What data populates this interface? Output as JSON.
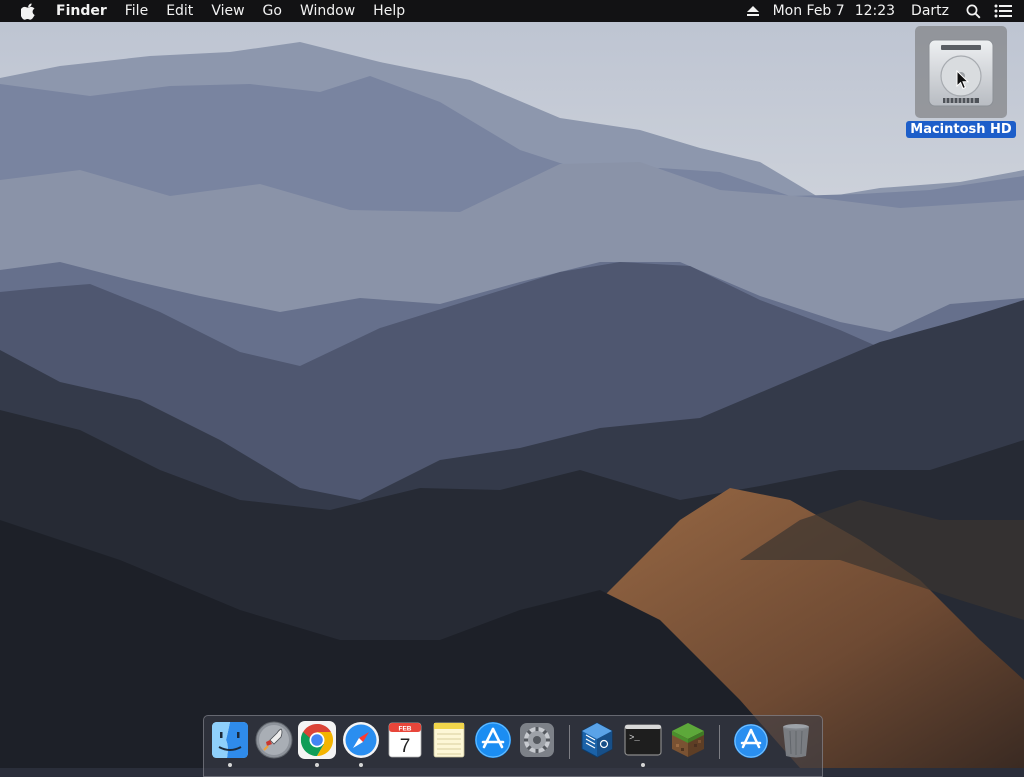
{
  "menubar": {
    "apple_icon": "apple-logo-icon",
    "app_name": "Finder",
    "menus": [
      "File",
      "Edit",
      "View",
      "Go",
      "Window",
      "Help"
    ],
    "status": {
      "eject_icon": "eject-icon",
      "date": "Mon Feb 7",
      "time": "12:23",
      "user": "Dartz",
      "spotlight_icon": "search-icon",
      "notification_icon": "list-icon"
    }
  },
  "desktop": {
    "icons": [
      {
        "label": "Macintosh HD",
        "icon": "hard-drive-icon",
        "selected": true
      }
    ]
  },
  "dock": {
    "apps": [
      {
        "icon": "finder-icon",
        "running": true
      },
      {
        "icon": "launchpad-icon",
        "running": false
      },
      {
        "icon": "chrome-icon",
        "running": true
      },
      {
        "icon": "safari-icon",
        "running": true
      },
      {
        "icon": "calendar-icon",
        "running": false,
        "month": "FEB",
        "day": "7"
      },
      {
        "icon": "notes-icon",
        "running": false
      },
      {
        "icon": "app-store-icon",
        "running": false
      },
      {
        "icon": "system-preferences-icon",
        "running": false
      },
      {
        "icon": "virtualbox-icon",
        "running": false
      },
      {
        "icon": "terminal-icon",
        "running": true,
        "prompt": ">_"
      },
      {
        "icon": "minecraft-icon",
        "running": false
      },
      {
        "icon": "applications-folder-icon",
        "running": false
      },
      {
        "icon": "trash-icon",
        "running": false
      }
    ]
  },
  "colors": {
    "menubar_bg": "#121214",
    "selection_blue": "#1d5ec9",
    "sky": "#cdd3dc"
  }
}
